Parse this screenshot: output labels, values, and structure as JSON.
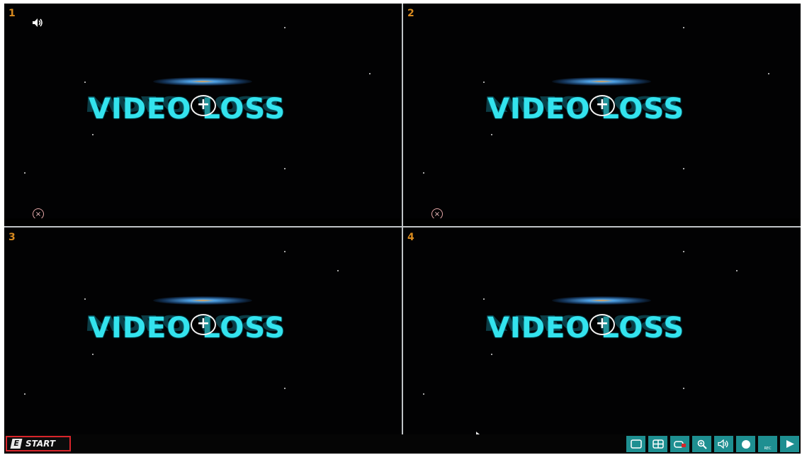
{
  "channels": [
    {
      "number": "1",
      "status_text": "VIDEO LOSS",
      "audio_icon": "speaker-icon",
      "has_close": true
    },
    {
      "number": "2",
      "status_text": "VIDEO LOSS",
      "has_close": true
    },
    {
      "number": "3",
      "status_text": "VIDEO LOSS"
    },
    {
      "number": "4",
      "status_text": "VIDEO LOSS"
    }
  ],
  "vl": {
    "left": "VIDE",
    "right": "LOSS"
  },
  "taskbar": {
    "start_label": "START",
    "start_logo": "E",
    "icons": [
      "single-view-icon",
      "quad-view-icon",
      "sequence-icon",
      "zoom-icon",
      "volume-icon",
      "record-dot-icon",
      "rec-icon",
      "play-icon"
    ],
    "rec_label": "REC"
  },
  "colors": {
    "channel_number": "#d88a1f",
    "video_loss_text": "#33e3ee",
    "taskbar_icon_bg": "#1e8f91",
    "start_border": "#d8252b"
  }
}
